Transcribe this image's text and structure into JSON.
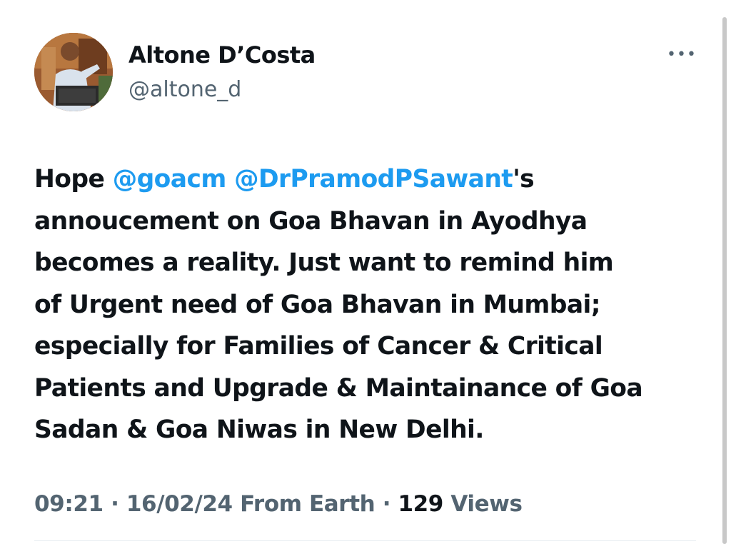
{
  "tweet": {
    "author": {
      "name": "Altone D’Costa",
      "handle": "@altone_d"
    },
    "more_label": "•••",
    "text_lines": [
      [
        {
          "t": "Hope "
        },
        {
          "t": "@goacm",
          "mention": true
        },
        {
          "t": " "
        },
        {
          "t": "@DrPramodPSawant",
          "mention": true
        },
        {
          "t": "'s"
        }
      ],
      [
        {
          "t": "annoucement on Goa Bhavan in Ayodhya"
        }
      ],
      [
        {
          "t": "becomes a reality. Just want to remind him"
        }
      ],
      [
        {
          "t": "of Urgent need of Goa Bhavan in Mumbai;"
        }
      ],
      [
        {
          "t": "especially for Families of Cancer & Critical"
        }
      ],
      [
        {
          "t": "Patients and Upgrade & Maintainance of Goa"
        }
      ],
      [
        {
          "t": "Sadan & Goa Niwas in New Delhi."
        }
      ]
    ],
    "meta": {
      "time": "09:21",
      "separator": " · ",
      "date": "16/02/24",
      "source": "From Earth",
      "views_count": "129",
      "views_label": "Views"
    }
  },
  "colors": {
    "mention": "#1d9bf0",
    "text": "#0f1419",
    "secondary": "#536471"
  }
}
